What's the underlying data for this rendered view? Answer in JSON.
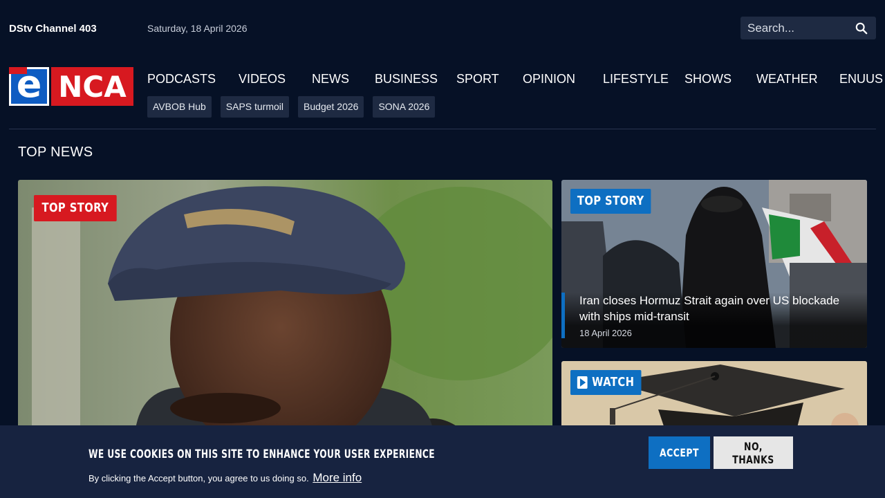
{
  "header": {
    "channel": "DStv Channel 403",
    "date": "Saturday, 18 April 2026",
    "search_placeholder": "Search...",
    "logo": {
      "e": "e",
      "nca": "NCA"
    }
  },
  "nav": {
    "items": [
      "PODCASTS",
      "VIDEOS",
      "NEWS",
      "BUSINESS",
      "SPORT",
      "OPINION",
      "LIFESTYLE",
      "SHOWS",
      "WEATHER",
      "ENUUS"
    ]
  },
  "tags": [
    "AVBOB Hub",
    "SAPS turmoil",
    "Budget 2026",
    "SONA 2026"
  ],
  "top_news": {
    "title": "TOP NEWS",
    "hero": {
      "badge": "TOP STORY"
    },
    "card1": {
      "badge": "TOP STORY",
      "headline": "Iran closes Hormuz Strait again over US blockade with ships mid-transit",
      "date": "18 April 2026"
    },
    "card2": {
      "badge": "WATCH"
    }
  },
  "cookie": {
    "title": "WE USE COOKIES ON THIS SITE TO ENHANCE YOUR USER EXPERIENCE",
    "text": "By clicking the Accept button, you agree to us doing so.",
    "link": "More info",
    "accept": "ACCEPT",
    "decline": "NO, THANKS"
  },
  "colors": {
    "background": "#061126",
    "brand_red": "#d71920",
    "brand_blue": "#0e6fc2",
    "banner": "#172340"
  }
}
